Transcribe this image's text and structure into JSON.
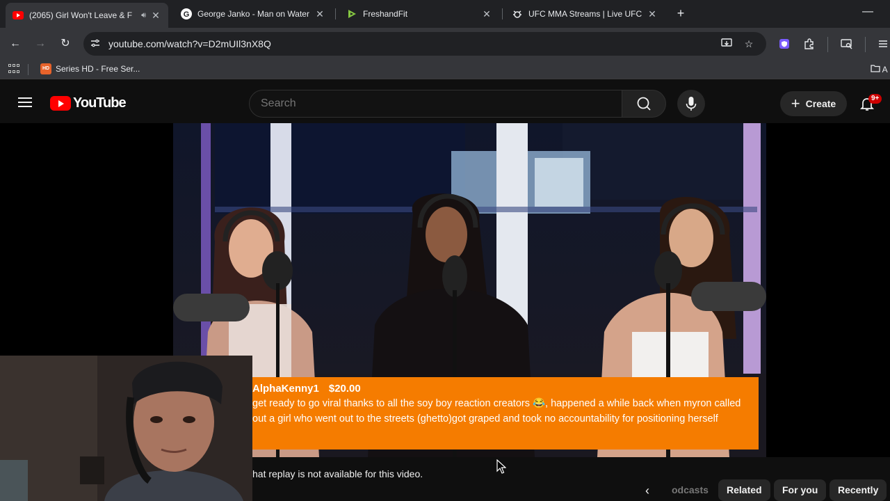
{
  "browser": {
    "tabs": [
      {
        "title": "(2065) Girl Won't Leave & F",
        "active": true,
        "favicon": "youtube-icon"
      },
      {
        "title": "George Janko - Man on Water",
        "active": false,
        "favicon": "google-icon"
      },
      {
        "title": "FreshandFit",
        "active": false,
        "favicon": "rumble-icon"
      },
      {
        "title": "UFC MMA Streams | Live UFC C",
        "active": false,
        "favicon": "bug-icon"
      }
    ],
    "url": "youtube.com/watch?v=D2mUIl3nX8Q",
    "bookmarks": [
      {
        "label": "Series HD - Free Ser...",
        "favicon_text": "HD"
      }
    ],
    "bookmark_folder_label": "A"
  },
  "youtube": {
    "logo_text": "YouTube",
    "search_placeholder": "Search",
    "create_label": "Create",
    "notification_count": "9+"
  },
  "superchat": {
    "username": "AlphaKenny1",
    "amount": "$20.00",
    "message": "get ready to go viral thanks to all the soy boy reaction creators 😂, happened a while back when myron called out a girl who went out to the streets (ghetto)got graped and took no accountability for positioning herself",
    "color": "#f57c00"
  },
  "chat": {
    "replay_notice": "hat replay is not available for this video."
  },
  "chips": [
    {
      "label": "odcasts",
      "faded": true
    },
    {
      "label": "Related",
      "faded": false
    },
    {
      "label": "For you",
      "faded": false
    },
    {
      "label": "Recently",
      "faded": false
    }
  ],
  "colors": {
    "youtube_red": "#ff0000",
    "badge_red": "#cc0000",
    "superchat_orange": "#f57c00",
    "background": "#0f0f0f"
  }
}
